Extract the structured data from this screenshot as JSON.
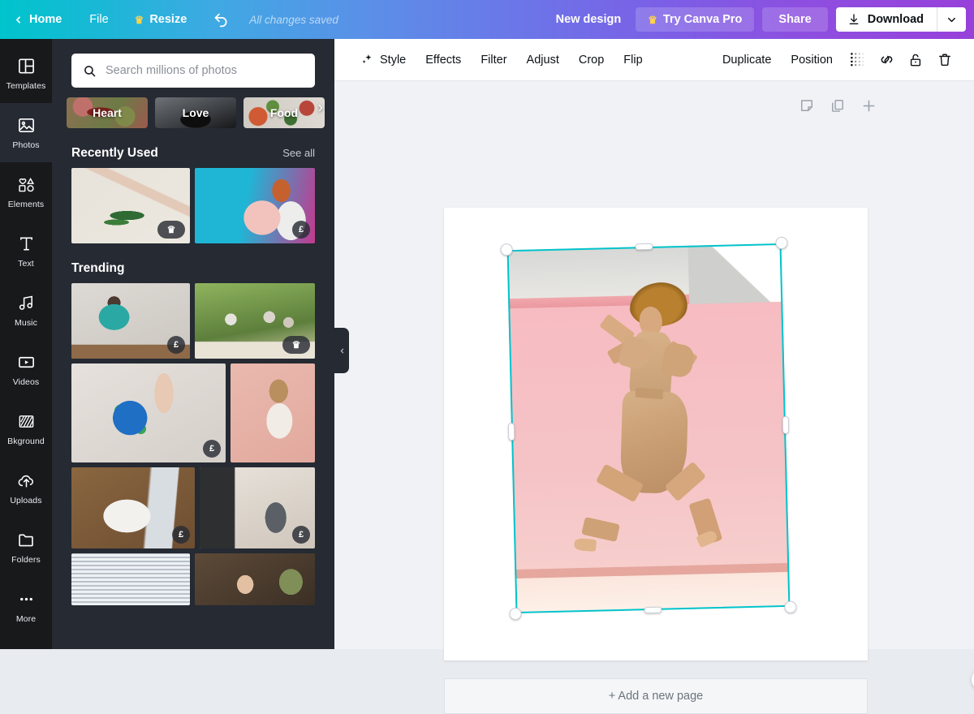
{
  "topbar": {
    "home": "Home",
    "file": "File",
    "resize": "Resize",
    "undo_icon": "undo-icon",
    "saved_status": "All changes saved",
    "new_design": "New design",
    "try_pro": "Try Canva Pro",
    "share": "Share",
    "download": "Download",
    "download_caret_icon": "chevron-down-icon",
    "gradient_start": "#00c4cc",
    "gradient_end": "#9740da"
  },
  "rail": {
    "items": [
      {
        "label": "Templates",
        "icon": "templates-icon",
        "active": false
      },
      {
        "label": "Photos",
        "icon": "photos-icon",
        "active": true
      },
      {
        "label": "Elements",
        "icon": "elements-icon",
        "active": false
      },
      {
        "label": "Text",
        "icon": "text-icon",
        "active": false
      },
      {
        "label": "Music",
        "icon": "music-icon",
        "active": false
      },
      {
        "label": "Videos",
        "icon": "videos-icon",
        "active": false
      },
      {
        "label": "Bkground",
        "icon": "background-icon",
        "active": false
      },
      {
        "label": "Uploads",
        "icon": "uploads-icon",
        "active": false
      },
      {
        "label": "Folders",
        "icon": "folders-icon",
        "active": false
      },
      {
        "label": "More",
        "icon": "more-icon",
        "active": false
      }
    ]
  },
  "panel": {
    "search": {
      "placeholder": "Search millions of photos",
      "value": "",
      "icon": "search-icon"
    },
    "chips": [
      {
        "label": "Heart"
      },
      {
        "label": "Love"
      },
      {
        "label": "Food"
      }
    ],
    "chips_next_icon": "chevron-right-icon",
    "recently_used": {
      "title": "Recently Used",
      "see_all": "See all",
      "items": [
        {
          "badge": "crown",
          "alt": "hand holding palm leaf"
        },
        {
          "badge": "£",
          "alt": "woman with pink flowers"
        }
      ]
    },
    "trending": {
      "title": "Trending",
      "items": [
        {
          "badge": "£",
          "alt": "man at kitchen counter"
        },
        {
          "badge": "crown",
          "alt": "friends toasting outdoors"
        },
        {
          "badge": "£",
          "alt": "hands holding globe"
        },
        {
          "badge": "",
          "alt": "woman in white shirt pink wall"
        },
        {
          "badge": "£",
          "alt": "washing greens in sink"
        },
        {
          "badge": "£",
          "alt": "woman by fireplace with cat"
        },
        {
          "badge": "",
          "alt": "window blinds"
        },
        {
          "badge": "",
          "alt": "bearded man in shop"
        }
      ]
    },
    "collapse_icon": "chevron-left-icon"
  },
  "toolbar": {
    "style": "Style",
    "style_icon": "sparkle-icon",
    "effects": "Effects",
    "filter": "Filter",
    "adjust": "Adjust",
    "crop": "Crop",
    "flip": "Flip",
    "duplicate": "Duplicate",
    "position": "Position",
    "transparency_icon": "transparency-icon",
    "link_icon": "link-icon",
    "lock_icon": "lock-icon",
    "delete_icon": "trash-icon"
  },
  "page_tools": {
    "notes_icon": "notes-icon",
    "duplicate_page_icon": "duplicate-page-icon",
    "add_page_icon": "plus-icon"
  },
  "canvas": {
    "selection": {
      "accent_color": "#00c4cc",
      "rotation_deg": -1.4,
      "rotate_icon": "rotate-icon"
    },
    "side_rotate_icon": "rotate-add-icon",
    "add_new_page": "+ Add a new page"
  }
}
